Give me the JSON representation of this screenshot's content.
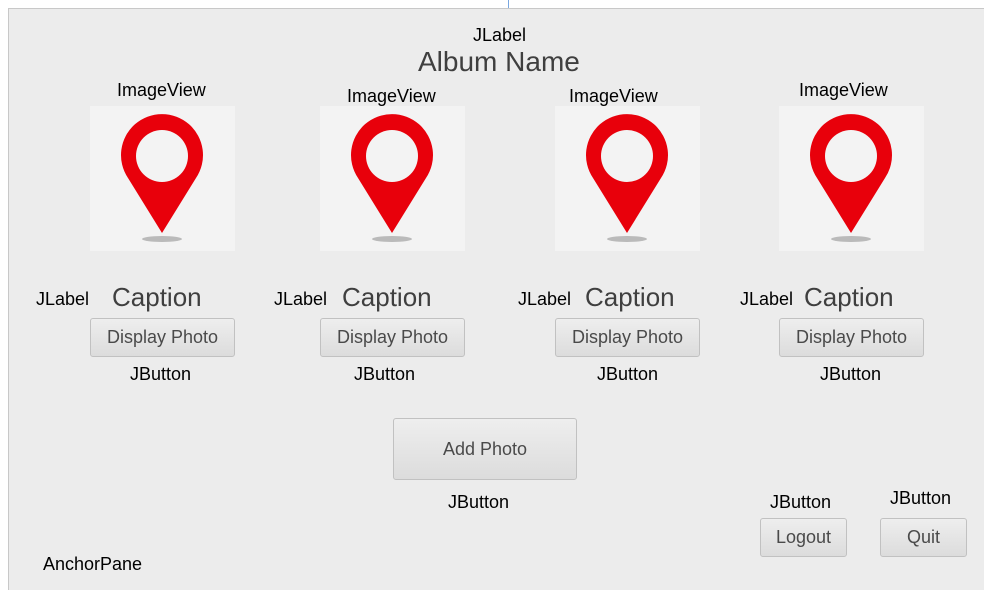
{
  "header": {
    "title_type_label": "JLabel",
    "album_title": "Album Name"
  },
  "photos": [
    {
      "image_type_label": "ImageView",
      "caption_type_label": "JLabel",
      "caption": "Caption",
      "button_label": "Display Photo",
      "button_type_label": "JButton",
      "icon": "map-pin-icon"
    },
    {
      "image_type_label": "ImageView",
      "caption_type_label": "JLabel",
      "caption": "Caption",
      "button_label": "Display Photo",
      "button_type_label": "JButton",
      "icon": "map-pin-icon"
    },
    {
      "image_type_label": "ImageView",
      "caption_type_label": "JLabel",
      "caption": "Caption",
      "button_label": "Display Photo",
      "button_type_label": "JButton",
      "icon": "map-pin-icon"
    },
    {
      "image_type_label": "ImageView",
      "caption_type_label": "JLabel",
      "caption": "Caption",
      "button_label": "Display Photo",
      "button_type_label": "JButton",
      "icon": "map-pin-icon"
    }
  ],
  "actions": {
    "add_photo_label": "Add Photo",
    "add_photo_type_label": "JButton",
    "logout_label": "Logout",
    "logout_type_label": "JButton",
    "quit_label": "Quit",
    "quit_type_label": "JButton"
  },
  "container_type_label": "AnchorPane",
  "colors": {
    "pin": "#e8000b",
    "background": "#ececec",
    "image_background": "#f3f3f3"
  }
}
